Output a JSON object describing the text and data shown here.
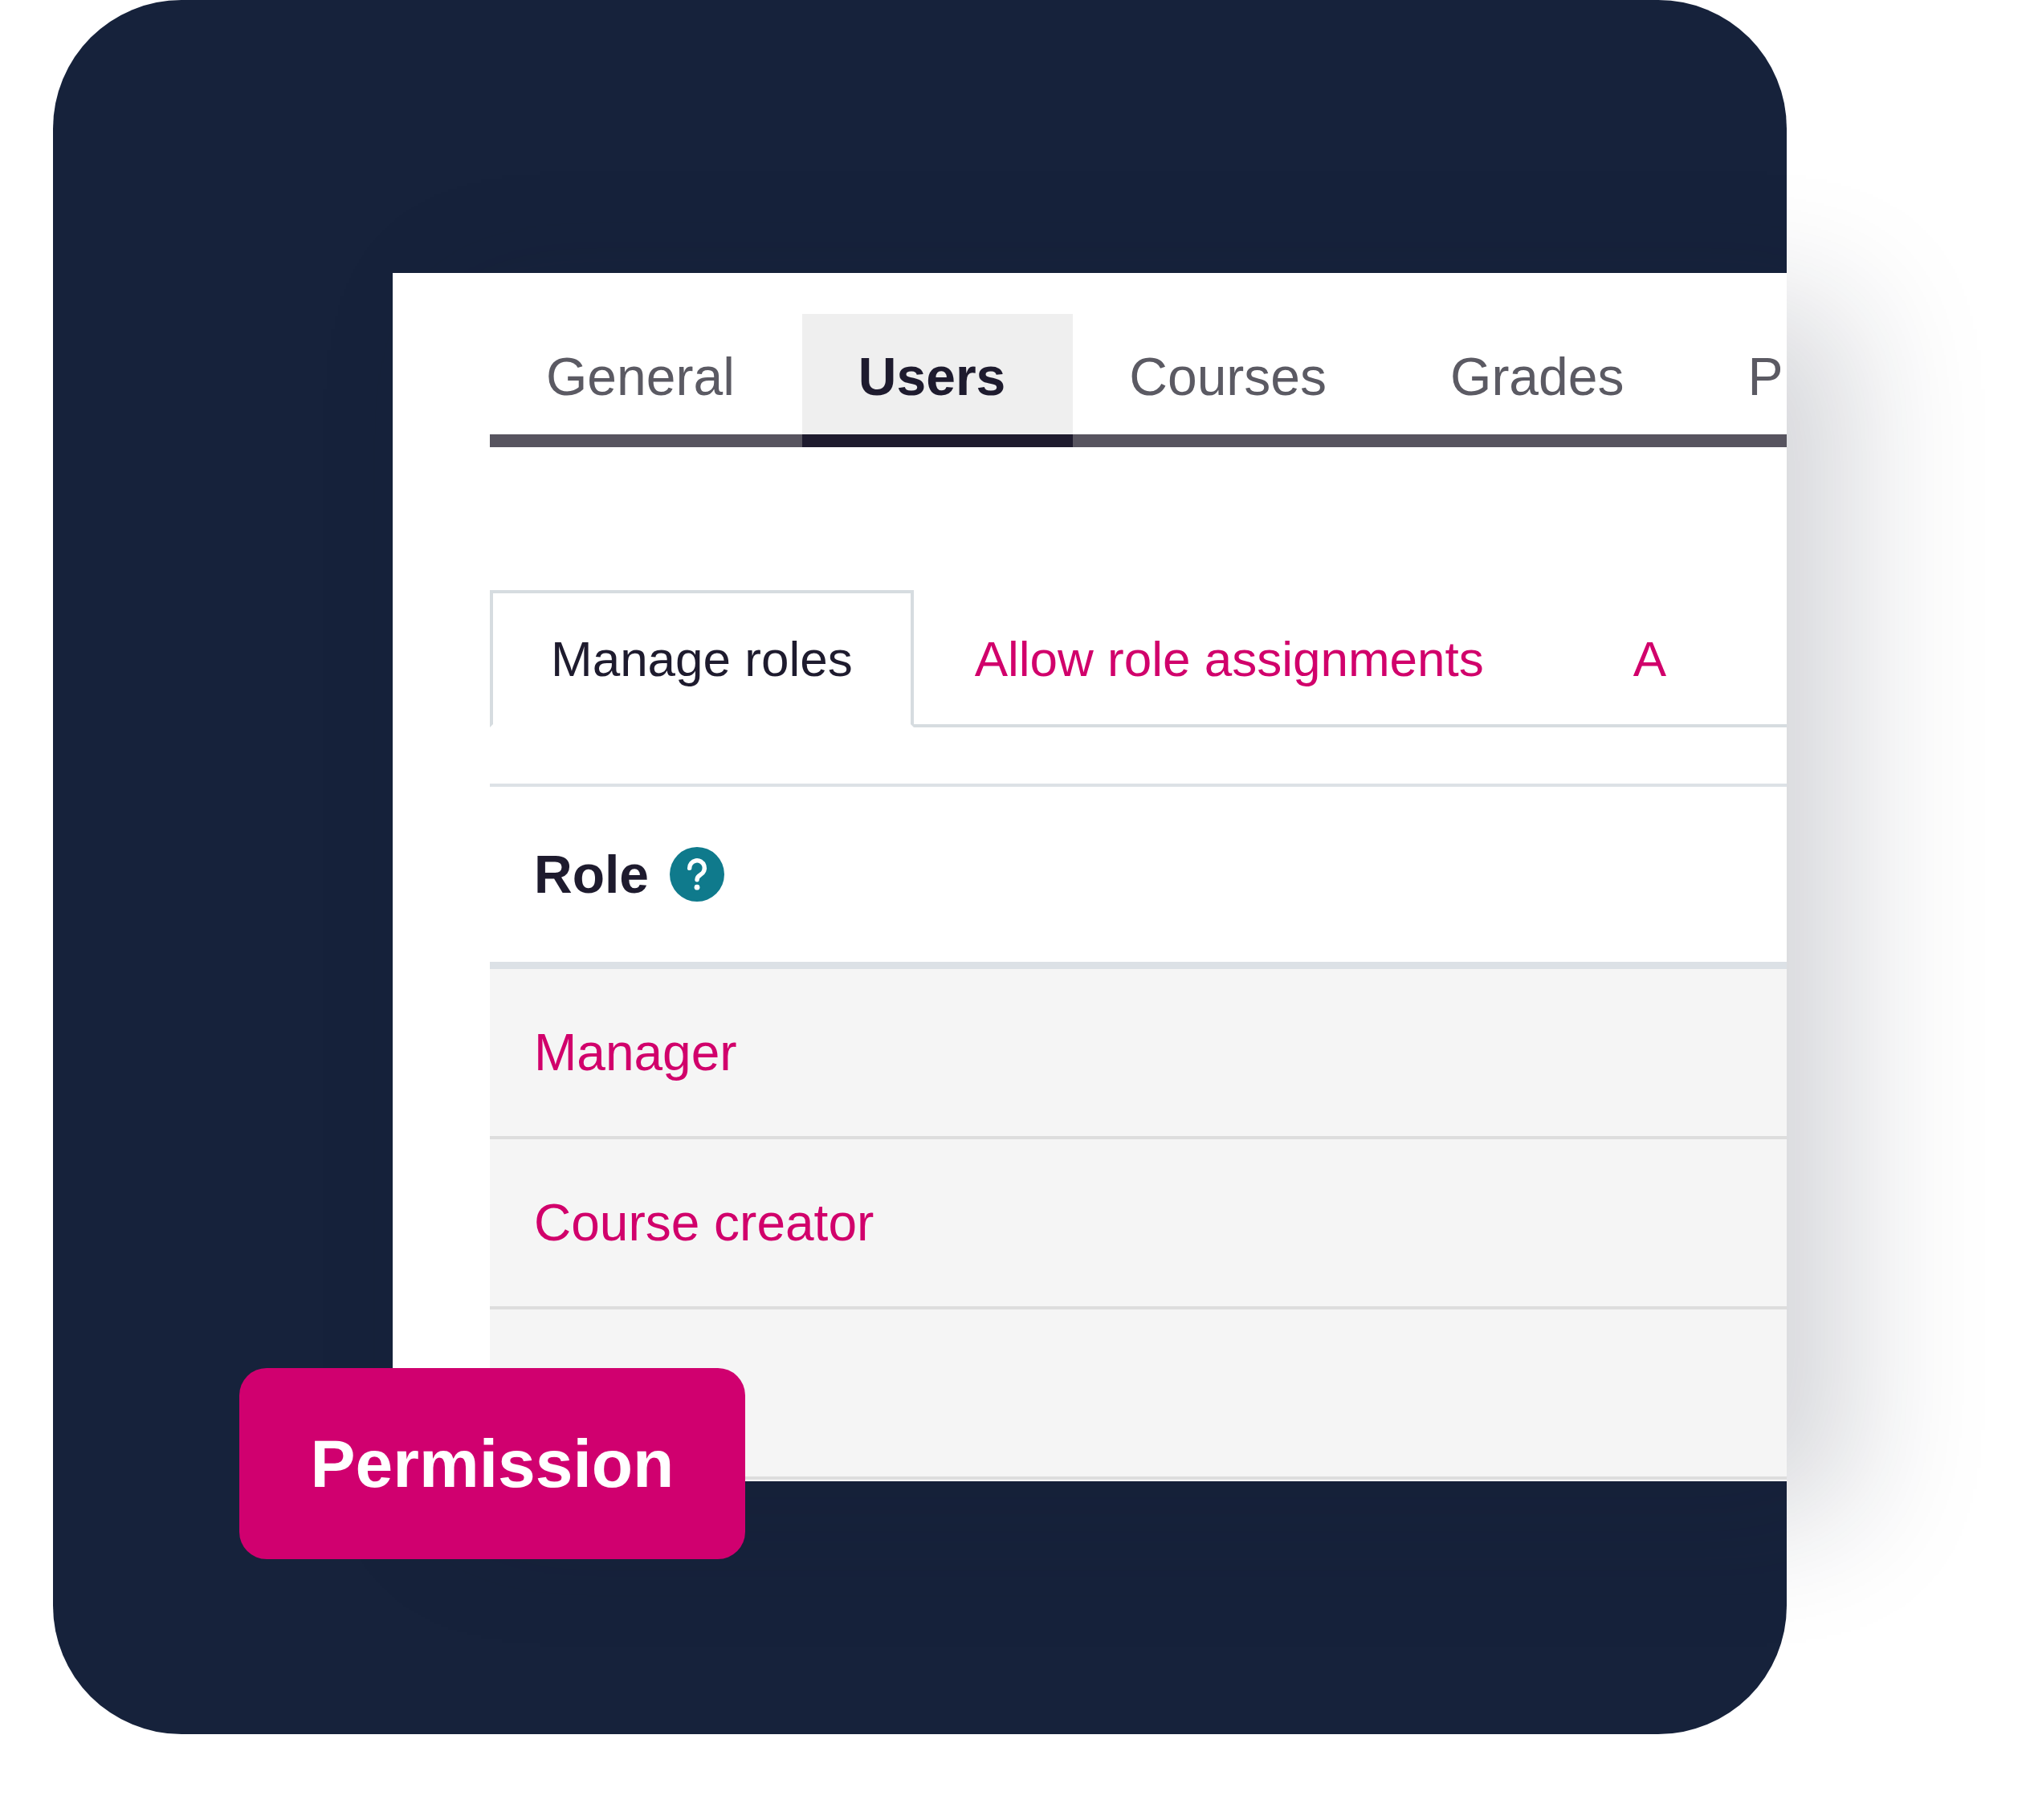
{
  "tabs": [
    {
      "label": "General",
      "selected": false
    },
    {
      "label": "Users",
      "selected": true
    },
    {
      "label": "Courses",
      "selected": false
    },
    {
      "label": "Grades",
      "selected": false
    },
    {
      "label": "P",
      "selected": false
    }
  ],
  "subtabs": [
    {
      "label": "Manage roles",
      "selected": true
    },
    {
      "label": "Allow role assignments",
      "selected": false
    },
    {
      "label": "A",
      "selected": false
    }
  ],
  "table": {
    "columns": [
      {
        "label": "Role",
        "help": true
      }
    ],
    "rows": [
      {
        "label": "Manager"
      },
      {
        "label": "Course creator"
      }
    ]
  },
  "badge": {
    "label": "Permission"
  }
}
